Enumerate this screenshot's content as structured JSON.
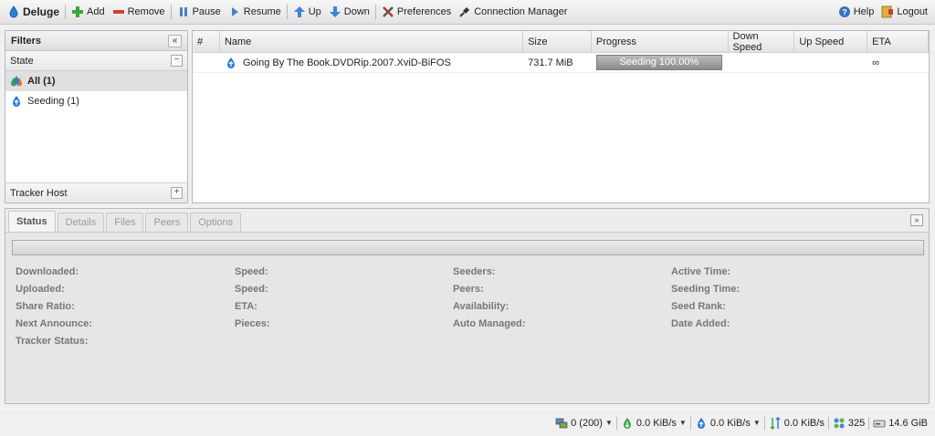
{
  "app": {
    "name": "Deluge"
  },
  "toolbar": {
    "add": "Add",
    "remove": "Remove",
    "pause": "Pause",
    "resume": "Resume",
    "up": "Up",
    "down": "Down",
    "preferences": "Preferences",
    "connection_manager": "Connection Manager",
    "help": "Help",
    "logout": "Logout"
  },
  "filters": {
    "title": "Filters",
    "collapse_glyph": "«",
    "state_header": "State",
    "state_toggle": "−",
    "items": [
      {
        "label": "All (1)",
        "icon": "all-icon",
        "selected": true
      },
      {
        "label": "Seeding (1)",
        "icon": "seeding-icon",
        "selected": false
      }
    ],
    "tracker_header": "Tracker Host",
    "tracker_toggle": "+"
  },
  "grid": {
    "columns": [
      "#",
      "Name",
      "Size",
      "Progress",
      "Down Speed",
      "Up Speed",
      "ETA"
    ],
    "rows": [
      {
        "num": "",
        "name": "Going By The Book.DVDRip.2007.XviD-BiFOS",
        "size": "731.7 MiB",
        "progress_label": "Seeding 100.00%",
        "progress": 1.0,
        "down": "",
        "up": "",
        "eta": "∞"
      }
    ]
  },
  "details": {
    "tabs": [
      "Status",
      "Details",
      "Files",
      "Peers",
      "Options"
    ],
    "active_tab": "Status",
    "expand_glyph": "»",
    "columns": [
      [
        "Downloaded:",
        "Uploaded:",
        "Share Ratio:",
        "Next Announce:",
        "Tracker Status:"
      ],
      [
        "Speed:",
        "Speed:",
        "ETA:",
        "Pieces:"
      ],
      [
        "Seeders:",
        "Peers:",
        "Availability:",
        "Auto Managed:"
      ],
      [
        "Active Time:",
        "Seeding Time:",
        "Seed Rank:",
        "Date Added:"
      ]
    ]
  },
  "statusbar": {
    "connections": "0 (200)",
    "download": "0.0 KiB/s",
    "upload": "0.0 KiB/s",
    "protocol": "0.0 KiB/s",
    "dht": "325",
    "free_space": "14.6 GiB"
  },
  "colors": {
    "add": "#3aa63a",
    "remove": "#d23c3c",
    "seed_blue": "#2a7fd6",
    "progress_gray": "#9a9a9a"
  }
}
